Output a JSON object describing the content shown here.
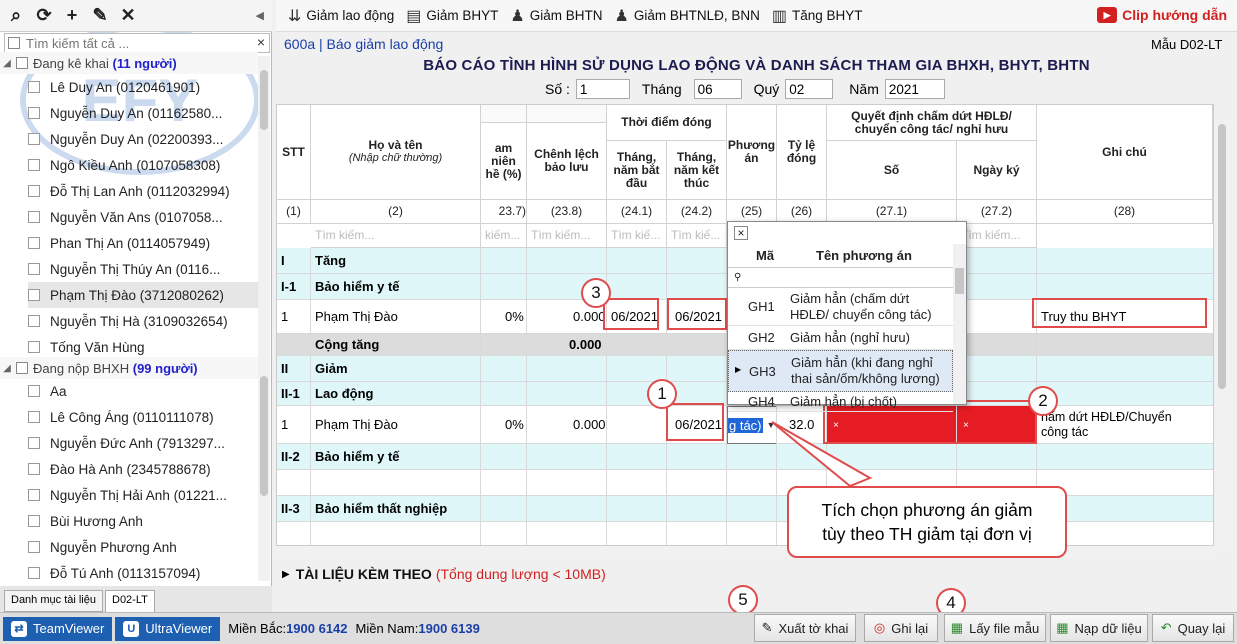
{
  "left_panel": {
    "toolbar_icons": [
      "search-icon",
      "refresh-icon",
      "add-icon",
      "edit-icon",
      "delete-icon"
    ],
    "search_placeholder": "Tìm kiếm tất cả ...",
    "group1": {
      "label": "Đang kê khai",
      "count": "(11 người)"
    },
    "group1_items": [
      "Lê Duy An (0120461901)",
      "Nguyễn Duy An (01162580...",
      "Nguyễn Duy An (02200393...",
      "Ngô Kiều Anh (0107058308)",
      "Đỗ Thị Lan Anh (0112032994)",
      "Nguyễn Văn Ans (0107058...",
      "Phan Thị An (0114057949)",
      "Nguyễn Thị Thúy An (0116...",
      "Phạm Thị Đào (3712080262)",
      "Nguyễn Thị Hà (3109032654)",
      "Tống Văn Hùng"
    ],
    "group2": {
      "label": "Đang nộp BHXH",
      "count": "(99 người)"
    },
    "group2_items": [
      "Aa",
      "Lê Công Áng (0110111078)",
      "Nguyễn Đức Anh (7913297...",
      "Đào Hà Anh (2345788678)",
      "Nguyễn Thị Hải Anh (01221...",
      "Bùi Hương Anh",
      "Nguyễn Phương Anh",
      "Đỗ Tú Anh (0113157094)"
    ],
    "tabs": [
      "Danh mục tài liệu",
      "D02-LT"
    ]
  },
  "toolbar": {
    "buttons": [
      "Giảm lao động",
      "Giảm BHYT",
      "Giảm BHTN",
      "Giảm BHTNLĐ, BNN",
      "Tăng BHYT"
    ],
    "clip": "Clip hướng dẫn"
  },
  "form": {
    "code": "600a | Báo giảm lao động",
    "template": "Mẫu D02-LT",
    "title": "BÁO CÁO TÌNH HÌNH SỬ DỤNG LAO ĐỘNG VÀ DANH SÁCH THAM GIA BHXH, BHYT, BHTN",
    "so_label": "Số :",
    "so": "1",
    "thang_label": "Tháng",
    "thang": "06",
    "quy_label": "Quý",
    "quy": "02",
    "nam_label": "Năm",
    "nam": "2021"
  },
  "grid": {
    "headers": {
      "stt": "STT",
      "name": "Họ và tên",
      "name_sub": "(Nhập chữ thường)",
      "tham_nien": "am niên\nhề (%)",
      "chenh_lech": "Chênh lệch\nbảo lưu",
      "thoi_diem": "Thời điểm đóng",
      "bat_dau": "Tháng,\nnăm bắt\nđầu",
      "ket_thuc": "Tháng,\nnăm kết\nthúc",
      "phuong_an": "Phương\nán",
      "ty_le": "Tỷ lệ\nđóng",
      "quyet_dinh": "Quyết định chấm dứt HĐLĐ/\nchuyển công tác/ nghỉ hưu",
      "so": "Số",
      "ngay_ky": "Ngày ký",
      "ghi_chu": "Ghi chú"
    },
    "col_nums": [
      "(1)",
      "(2)",
      "23.7)",
      "(23.8)",
      "(24.1)",
      "(24.2)",
      "(25)",
      "(26)",
      "(27.1)",
      "(27.2)",
      "(28)"
    ],
    "filter": [
      "Tìm kiếm...",
      "kiếm...",
      "Tìm kiếm...",
      "Tìm kiế...",
      "Tìm kiế...",
      "Tìm kiếm..."
    ],
    "rows": {
      "i": [
        "I",
        "Tăng"
      ],
      "i1": [
        "I-1",
        "Bảo hiểm y tế"
      ],
      "r1": {
        "stt": "1",
        "name": "Phạm Thị Đào",
        "pct": "0%",
        "cl": "0.000",
        "bd": "06/2021",
        "kt": "06/2021",
        "note": "Truy thu BHYT"
      },
      "cong_tang": {
        "label": "Cộng tăng",
        "val": "0.000"
      },
      "ii": [
        "II",
        "Giảm"
      ],
      "ii1": [
        "II-1",
        "Lao động"
      ],
      "r2": {
        "stt": "1",
        "name": "Phạm Thị Đào",
        "pct": "0%",
        "cl": "0.000",
        "kt": "06/2021",
        "pa": "g tác)",
        "tl": "32.0",
        "x1": "×",
        "x2": "×",
        "note": "hấm dứt HĐLĐ/Chuyển\ncông tác"
      },
      "ii2": [
        "II-2",
        "Bảo hiểm y tế"
      ],
      "ii3": [
        "II-3",
        "Bảo hiểm thất nghiệp"
      ]
    }
  },
  "popup": {
    "close": "×",
    "col_ma": "Mã",
    "col_ten": "Tên phương án",
    "rows": [
      {
        "ma": "GH1",
        "ten": "Giảm hẳn (chấm dứt\nHĐLĐ/ chuyển công tác)"
      },
      {
        "ma": "GH2",
        "ten": "Giảm hẳn (nghỉ hưu)"
      },
      {
        "ma": "GH3",
        "ten": "Giảm hẳn (khi đang nghỉ\nthai sản/ốm/không lương)"
      },
      {
        "ma": "GH4",
        "ten": "Giảm hẳn (bị chốt)"
      }
    ]
  },
  "callout": "Tích chọn phương án giảm\ntùy theo TH giảm tại đơn vị",
  "markers": [
    "1",
    "2",
    "3",
    "4",
    "5"
  ],
  "attach": {
    "title": "TÀI LIỆU KÈM THEO",
    "note": "(Tổng dung lượng < 10MB)"
  },
  "status": {
    "teamviewer": "TeamViewer",
    "ultraviewer": "UltraViewer",
    "mb_label": "Miền Bắc:",
    "mb": "1900 6142",
    "mn_label": "Miền Nam:",
    "mn": "1900 6139",
    "buttons": [
      "Xuất tờ khai",
      "Ghi lại",
      "Lấy file mẫu",
      "Nạp dữ liệu",
      "Quay lại"
    ]
  },
  "colors": {
    "red": "#e04b4b",
    "cyan": "#e0f7f9",
    "blue": "#1a3fa8"
  }
}
